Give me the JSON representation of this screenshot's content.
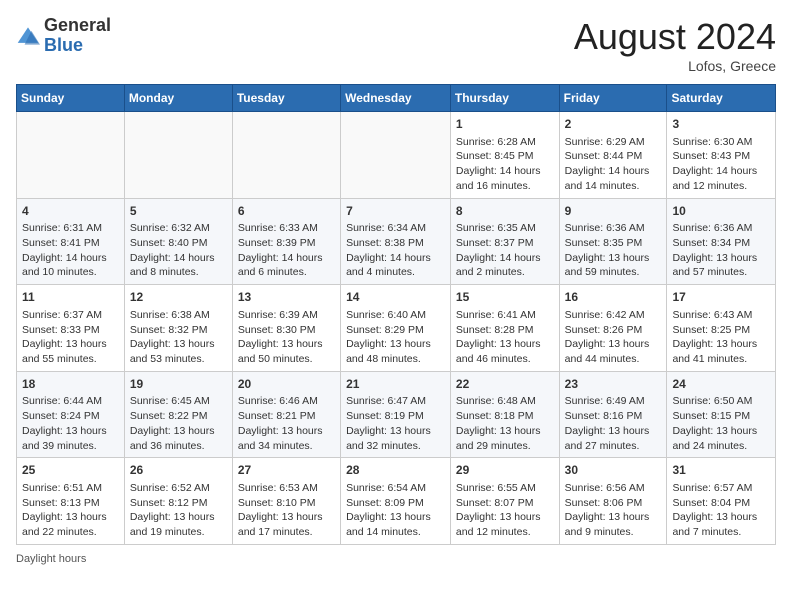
{
  "header": {
    "logo_general": "General",
    "logo_blue": "Blue",
    "month_title": "August 2024",
    "location": "Lofos, Greece"
  },
  "days_of_week": [
    "Sunday",
    "Monday",
    "Tuesday",
    "Wednesday",
    "Thursday",
    "Friday",
    "Saturday"
  ],
  "weeks": [
    [
      {
        "day": "",
        "info": ""
      },
      {
        "day": "",
        "info": ""
      },
      {
        "day": "",
        "info": ""
      },
      {
        "day": "",
        "info": ""
      },
      {
        "day": "1",
        "info": "Sunrise: 6:28 AM\nSunset: 8:45 PM\nDaylight: 14 hours and 16 minutes."
      },
      {
        "day": "2",
        "info": "Sunrise: 6:29 AM\nSunset: 8:44 PM\nDaylight: 14 hours and 14 minutes."
      },
      {
        "day": "3",
        "info": "Sunrise: 6:30 AM\nSunset: 8:43 PM\nDaylight: 14 hours and 12 minutes."
      }
    ],
    [
      {
        "day": "4",
        "info": "Sunrise: 6:31 AM\nSunset: 8:41 PM\nDaylight: 14 hours and 10 minutes."
      },
      {
        "day": "5",
        "info": "Sunrise: 6:32 AM\nSunset: 8:40 PM\nDaylight: 14 hours and 8 minutes."
      },
      {
        "day": "6",
        "info": "Sunrise: 6:33 AM\nSunset: 8:39 PM\nDaylight: 14 hours and 6 minutes."
      },
      {
        "day": "7",
        "info": "Sunrise: 6:34 AM\nSunset: 8:38 PM\nDaylight: 14 hours and 4 minutes."
      },
      {
        "day": "8",
        "info": "Sunrise: 6:35 AM\nSunset: 8:37 PM\nDaylight: 14 hours and 2 minutes."
      },
      {
        "day": "9",
        "info": "Sunrise: 6:36 AM\nSunset: 8:35 PM\nDaylight: 13 hours and 59 minutes."
      },
      {
        "day": "10",
        "info": "Sunrise: 6:36 AM\nSunset: 8:34 PM\nDaylight: 13 hours and 57 minutes."
      }
    ],
    [
      {
        "day": "11",
        "info": "Sunrise: 6:37 AM\nSunset: 8:33 PM\nDaylight: 13 hours and 55 minutes."
      },
      {
        "day": "12",
        "info": "Sunrise: 6:38 AM\nSunset: 8:32 PM\nDaylight: 13 hours and 53 minutes."
      },
      {
        "day": "13",
        "info": "Sunrise: 6:39 AM\nSunset: 8:30 PM\nDaylight: 13 hours and 50 minutes."
      },
      {
        "day": "14",
        "info": "Sunrise: 6:40 AM\nSunset: 8:29 PM\nDaylight: 13 hours and 48 minutes."
      },
      {
        "day": "15",
        "info": "Sunrise: 6:41 AM\nSunset: 8:28 PM\nDaylight: 13 hours and 46 minutes."
      },
      {
        "day": "16",
        "info": "Sunrise: 6:42 AM\nSunset: 8:26 PM\nDaylight: 13 hours and 44 minutes."
      },
      {
        "day": "17",
        "info": "Sunrise: 6:43 AM\nSunset: 8:25 PM\nDaylight: 13 hours and 41 minutes."
      }
    ],
    [
      {
        "day": "18",
        "info": "Sunrise: 6:44 AM\nSunset: 8:24 PM\nDaylight: 13 hours and 39 minutes."
      },
      {
        "day": "19",
        "info": "Sunrise: 6:45 AM\nSunset: 8:22 PM\nDaylight: 13 hours and 36 minutes."
      },
      {
        "day": "20",
        "info": "Sunrise: 6:46 AM\nSunset: 8:21 PM\nDaylight: 13 hours and 34 minutes."
      },
      {
        "day": "21",
        "info": "Sunrise: 6:47 AM\nSunset: 8:19 PM\nDaylight: 13 hours and 32 minutes."
      },
      {
        "day": "22",
        "info": "Sunrise: 6:48 AM\nSunset: 8:18 PM\nDaylight: 13 hours and 29 minutes."
      },
      {
        "day": "23",
        "info": "Sunrise: 6:49 AM\nSunset: 8:16 PM\nDaylight: 13 hours and 27 minutes."
      },
      {
        "day": "24",
        "info": "Sunrise: 6:50 AM\nSunset: 8:15 PM\nDaylight: 13 hours and 24 minutes."
      }
    ],
    [
      {
        "day": "25",
        "info": "Sunrise: 6:51 AM\nSunset: 8:13 PM\nDaylight: 13 hours and 22 minutes."
      },
      {
        "day": "26",
        "info": "Sunrise: 6:52 AM\nSunset: 8:12 PM\nDaylight: 13 hours and 19 minutes."
      },
      {
        "day": "27",
        "info": "Sunrise: 6:53 AM\nSunset: 8:10 PM\nDaylight: 13 hours and 17 minutes."
      },
      {
        "day": "28",
        "info": "Sunrise: 6:54 AM\nSunset: 8:09 PM\nDaylight: 13 hours and 14 minutes."
      },
      {
        "day": "29",
        "info": "Sunrise: 6:55 AM\nSunset: 8:07 PM\nDaylight: 13 hours and 12 minutes."
      },
      {
        "day": "30",
        "info": "Sunrise: 6:56 AM\nSunset: 8:06 PM\nDaylight: 13 hours and 9 minutes."
      },
      {
        "day": "31",
        "info": "Sunrise: 6:57 AM\nSunset: 8:04 PM\nDaylight: 13 hours and 7 minutes."
      }
    ]
  ],
  "footer": {
    "note": "Daylight hours"
  }
}
